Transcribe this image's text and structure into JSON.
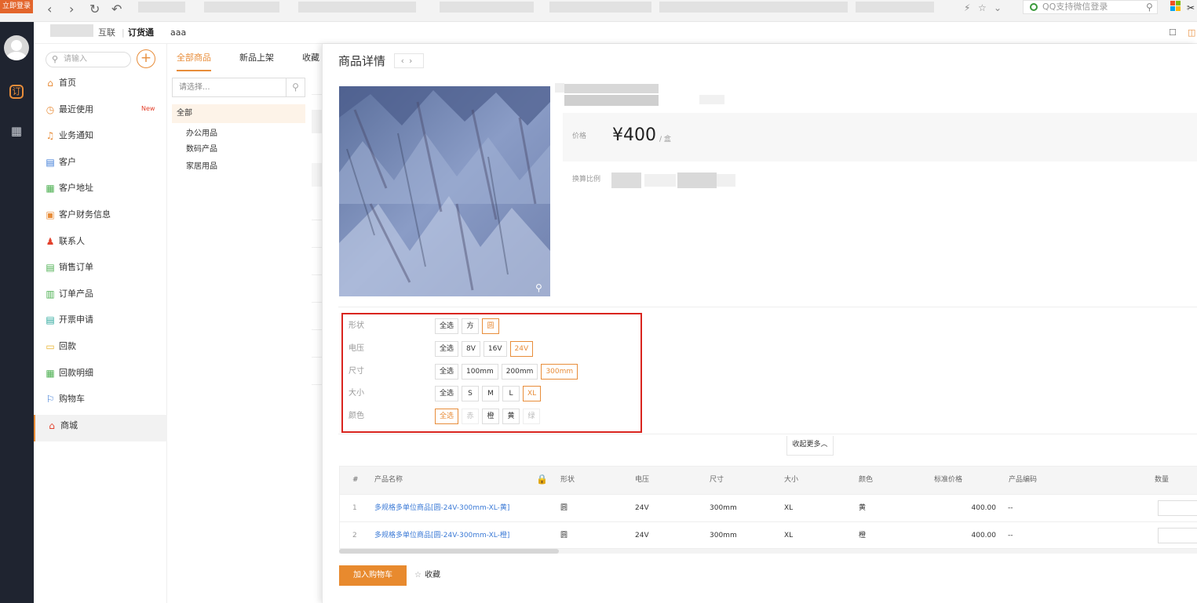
{
  "browser": {
    "login_label": "立即登录",
    "search_text": "QQ支持微信登录"
  },
  "topbar": {
    "org": "互联",
    "app": "订货通",
    "tenant": "aaa"
  },
  "sidebar": {
    "search_placeholder": "请输入",
    "items": [
      {
        "label": "首页",
        "icon": "home-icon",
        "color": "#e88d3a"
      },
      {
        "label": "最近使用",
        "icon": "clock-icon",
        "color": "#e88d3a",
        "badge": "New"
      },
      {
        "label": "业务通知",
        "icon": "bell-icon",
        "color": "#e88d3a"
      },
      {
        "label": "客户",
        "icon": "customer-icon",
        "color": "#3b7ad6"
      },
      {
        "label": "客户地址",
        "icon": "address-icon",
        "color": "#4caf50"
      },
      {
        "label": "客户财务信息",
        "icon": "finance-icon",
        "color": "#e88d3a"
      },
      {
        "label": "联系人",
        "icon": "contact-icon",
        "color": "#e3412c"
      },
      {
        "label": "销售订单",
        "icon": "order-icon",
        "color": "#4caf50"
      },
      {
        "label": "订单产品",
        "icon": "order-product-icon",
        "color": "#4caf50"
      },
      {
        "label": "开票申请",
        "icon": "invoice-icon",
        "color": "#26a69a"
      },
      {
        "label": "回款",
        "icon": "payment-icon",
        "color": "#e8b32e"
      },
      {
        "label": "回款明细",
        "icon": "payment-detail-icon",
        "color": "#4caf50"
      },
      {
        "label": "购物车",
        "icon": "flag-icon",
        "color": "#3b7ad6"
      },
      {
        "label": "商城",
        "icon": "shop-icon",
        "color": "#e3412c"
      }
    ]
  },
  "catpanel": {
    "tabs": [
      "全部商品",
      "新品上架",
      "收藏"
    ],
    "select_placeholder": "请选择...",
    "all_label": "全部",
    "subcats": [
      "办公用品",
      "数码产品",
      "家居用品"
    ]
  },
  "detail": {
    "title": "商品详情",
    "price_label": "价格",
    "price_value": "¥400",
    "price_unit": "/ 盒",
    "ratio_label": "换算比例",
    "specs": [
      {
        "name": "形状",
        "options": [
          "全选",
          "方",
          "圆"
        ],
        "selected": [
          2
        ],
        "disabled": []
      },
      {
        "name": "电压",
        "options": [
          "全选",
          "8V",
          "16V",
          "24V"
        ],
        "selected": [
          3
        ],
        "disabled": []
      },
      {
        "name": "尺寸",
        "options": [
          "全选",
          "100mm",
          "200mm",
          "300mm"
        ],
        "selected": [
          3
        ],
        "disabled": []
      },
      {
        "name": "大小",
        "options": [
          "全选",
          "S",
          "M",
          "L",
          "XL"
        ],
        "selected": [
          4
        ],
        "disabled": []
      },
      {
        "name": "颜色",
        "options": [
          "全选",
          "赤",
          "橙",
          "黄",
          "绿"
        ],
        "selected": [
          0
        ],
        "disabled": [
          1,
          4
        ]
      }
    ],
    "collapse_label": "收起更多︿",
    "table": {
      "headers": [
        "#",
        "产品名称",
        "形状",
        "电压",
        "尺寸",
        "大小",
        "颜色",
        "标准价格",
        "产品编码",
        "数量"
      ],
      "rows": [
        [
          "1",
          "多规格多单位商品[圆-24V-300mm-XL-黄]",
          "圆",
          "24V",
          "300mm",
          "XL",
          "黄",
          "400.00",
          "--"
        ],
        [
          "2",
          "多规格多单位商品[圆-24V-300mm-XL-橙]",
          "圆",
          "24V",
          "300mm",
          "XL",
          "橙",
          "400.00",
          "--"
        ]
      ]
    },
    "add_cart_label": "加入购物车",
    "favorite_label": "收藏"
  },
  "colors": {
    "accent": "#e88d3a",
    "highlight_frame": "#d9251f",
    "link": "#3b7ad6"
  }
}
